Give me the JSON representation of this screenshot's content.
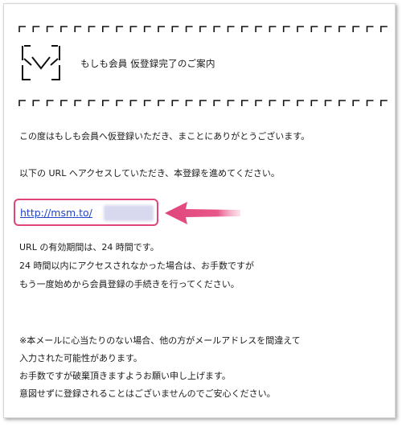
{
  "email": {
    "title": "もしも会員 仮登録完了のご案内",
    "greeting": "この度はもしも会員へ仮登録いただき、まことにありがとうございます。",
    "instruction": "以下の URL へアクセスしていただき、本登録を進めてください。",
    "registration_link": "http://msm.to/",
    "validity_lines": [
      "URL の有効期間は、24 時間です。",
      "24 時間以内にアクセスされなかった場合は、お手数ですが",
      "もう一度始めから会員登録の手続きを行ってください。"
    ],
    "notice_lines": [
      "※本メールに心当たりのない場合、他の方がメールアドレスを間違えて",
      "入力された可能性があります。",
      "お手数ですが破棄頂きますようお願い申し上げます。",
      "意図せずに登録されることはございませんのでご安心ください。"
    ]
  },
  "icons": {
    "header": "envelope-icon",
    "annotation": "arrow-left-icon"
  },
  "colors": {
    "highlight": "#e0457b",
    "link": "#2244cc",
    "text": "#1a1a1a"
  }
}
